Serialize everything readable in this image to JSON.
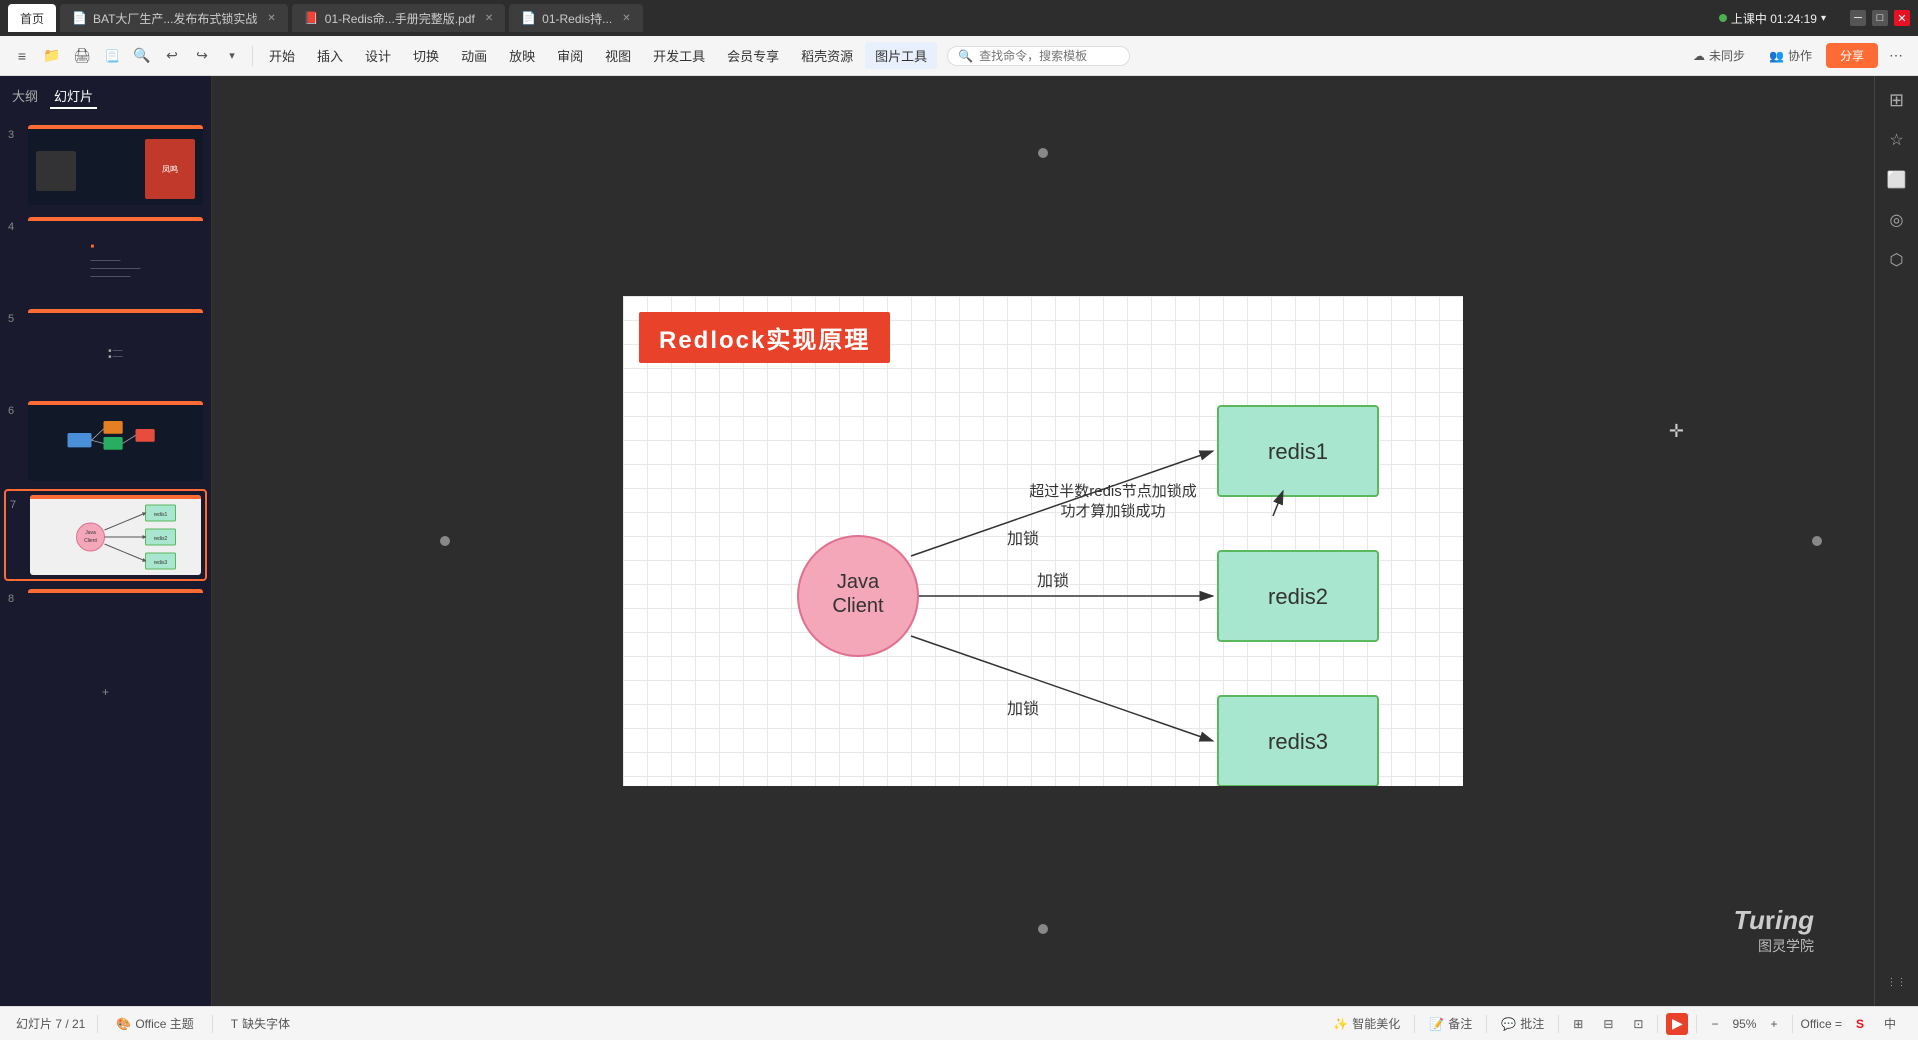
{
  "titleBar": {
    "tabs": [
      {
        "id": "home",
        "label": "首页",
        "active": true,
        "closable": false,
        "icon": ""
      },
      {
        "id": "bat",
        "label": "BAT大厂生产...发布布式锁实战",
        "active": false,
        "closable": true,
        "icon": "📄"
      },
      {
        "id": "redis-pdf",
        "label": "01-Redis命...手册完整版.pdf",
        "active": false,
        "closable": true,
        "icon": "📕"
      },
      {
        "id": "redis-hold",
        "label": "01-Redis持...",
        "active": false,
        "closable": true,
        "icon": "📄"
      }
    ],
    "live": {
      "dot_color": "#4caf50",
      "label": "上课中 01:24:19"
    },
    "windowControls": [
      "─",
      "□",
      "✕"
    ]
  },
  "menuBar": {
    "leftIcons": [
      "≡",
      "📁",
      "🖨",
      "🖨",
      "🔍",
      "↩",
      "↪",
      "▾"
    ],
    "items": [
      "开始",
      "插入",
      "设计",
      "切换",
      "动画",
      "放映",
      "审阅",
      "视图",
      "开发工具",
      "会员专享",
      "稻壳资源"
    ],
    "activeItem": "图片工具",
    "searchPlaceholder": "查找命令，搜索模板",
    "rightItems": [
      "未同步",
      "协作",
      "分享"
    ]
  },
  "sidebar": {
    "tabs": [
      "大纲",
      "幻灯片"
    ],
    "activeTab": "幻灯片",
    "slides": [
      {
        "num": "3",
        "selected": false,
        "hasOrangeBar": true,
        "preview": "qr_fengxing"
      },
      {
        "num": "4",
        "selected": false,
        "hasOrangeBar": true,
        "preview": "text_dark"
      },
      {
        "num": "5",
        "selected": false,
        "hasOrangeBar": true,
        "preview": "text_dark2"
      },
      {
        "num": "6",
        "selected": false,
        "hasOrangeBar": true,
        "preview": "diagram_colored"
      },
      {
        "num": "7",
        "selected": true,
        "hasOrangeBar": true,
        "preview": "diagram_current"
      },
      {
        "num": "8",
        "selected": false,
        "hasOrangeBar": true,
        "preview": "dark_empty"
      }
    ],
    "addButton": "+"
  },
  "slide": {
    "title": "Redlock实现原理",
    "diagram": {
      "clientLabel": "Java\nClient",
      "nodes": [
        "redis1",
        "redis2",
        "redis3"
      ],
      "arrows": [
        {
          "from": "client",
          "to": "redis1",
          "label": "加锁"
        },
        {
          "from": "client",
          "to": "redis2",
          "label": "加锁"
        },
        {
          "from": "client",
          "to": "redis3",
          "label": "加锁"
        }
      ],
      "annotation": "超过半数redis节点加锁成\n功才算加锁成功",
      "annotationArrowTo": "redis1"
    }
  },
  "rightPanel": {
    "icons": [
      "≡▤",
      "☆",
      "⬜",
      "◎",
      "⬡"
    ]
  },
  "bottomBar": {
    "slideInfo": "幻灯片 7 / 21",
    "theme": "Office 主题",
    "missingFont": "缺失字体",
    "smartBeautify": "智能美化",
    "notes": "备注",
    "comments": "批注",
    "viewIcons": [
      "⊞",
      "⊟",
      "⊡"
    ],
    "playBtn": "▶",
    "zoom": "95%",
    "officeLabel": "Office =",
    "sougouIcon": "S",
    "langIndicator": "中"
  },
  "turingLogo": {
    "name": "Turing",
    "stylized": "Turing",
    "subtitle": "图灵学院"
  }
}
